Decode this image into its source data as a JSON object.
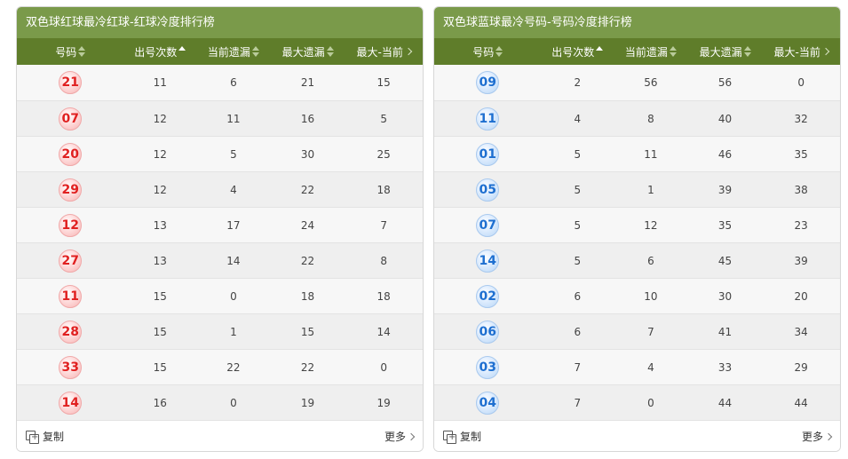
{
  "red_panel": {
    "title": "双色球红球最冷红球-红球冷度排行榜",
    "headers": [
      "号码",
      "出号次数",
      "当前遗漏",
      "最大遗漏",
      "最大-当前"
    ],
    "rows": [
      {
        "num": "21",
        "count": "11",
        "current": "6",
        "max": "21",
        "diff": "15"
      },
      {
        "num": "07",
        "count": "12",
        "current": "11",
        "max": "16",
        "diff": "5"
      },
      {
        "num": "20",
        "count": "12",
        "current": "5",
        "max": "30",
        "diff": "25"
      },
      {
        "num": "29",
        "count": "12",
        "current": "4",
        "max": "22",
        "diff": "18"
      },
      {
        "num": "12",
        "count": "13",
        "current": "17",
        "max": "24",
        "diff": "7"
      },
      {
        "num": "27",
        "count": "13",
        "current": "14",
        "max": "22",
        "diff": "8"
      },
      {
        "num": "11",
        "count": "15",
        "current": "0",
        "max": "18",
        "diff": "18"
      },
      {
        "num": "28",
        "count": "15",
        "current": "1",
        "max": "15",
        "diff": "14"
      },
      {
        "num": "33",
        "count": "15",
        "current": "22",
        "max": "22",
        "diff": "0"
      },
      {
        "num": "14",
        "count": "16",
        "current": "0",
        "max": "19",
        "diff": "19"
      }
    ],
    "copy_label": "复制",
    "more_label": "更多"
  },
  "blue_panel": {
    "title": "双色球蓝球最冷号码-号码冷度排行榜",
    "headers": [
      "号码",
      "出号次数",
      "当前遗漏",
      "最大遗漏",
      "最大-当前"
    ],
    "rows": [
      {
        "num": "09",
        "count": "2",
        "current": "56",
        "max": "56",
        "diff": "0"
      },
      {
        "num": "11",
        "count": "4",
        "current": "8",
        "max": "40",
        "diff": "32"
      },
      {
        "num": "01",
        "count": "5",
        "current": "11",
        "max": "46",
        "diff": "35"
      },
      {
        "num": "05",
        "count": "5",
        "current": "1",
        "max": "39",
        "diff": "38"
      },
      {
        "num": "07",
        "count": "5",
        "current": "12",
        "max": "35",
        "diff": "23"
      },
      {
        "num": "14",
        "count": "5",
        "current": "6",
        "max": "45",
        "diff": "39"
      },
      {
        "num": "02",
        "count": "6",
        "current": "10",
        "max": "30",
        "diff": "20"
      },
      {
        "num": "06",
        "count": "6",
        "current": "7",
        "max": "41",
        "diff": "34"
      },
      {
        "num": "03",
        "count": "7",
        "current": "4",
        "max": "33",
        "diff": "29"
      },
      {
        "num": "04",
        "count": "7",
        "current": "0",
        "max": "44",
        "diff": "44"
      }
    ],
    "copy_label": "复制",
    "more_label": "更多"
  },
  "icons": {
    "sort": "sort-icon",
    "chevron": "chevron-right-icon",
    "copy": "copy-icon"
  },
  "colors": {
    "title_bg": "#7a9a4a",
    "header_bg": "#5f7d2a",
    "red_ball": "#e02020",
    "blue_ball": "#1e6fd0"
  }
}
